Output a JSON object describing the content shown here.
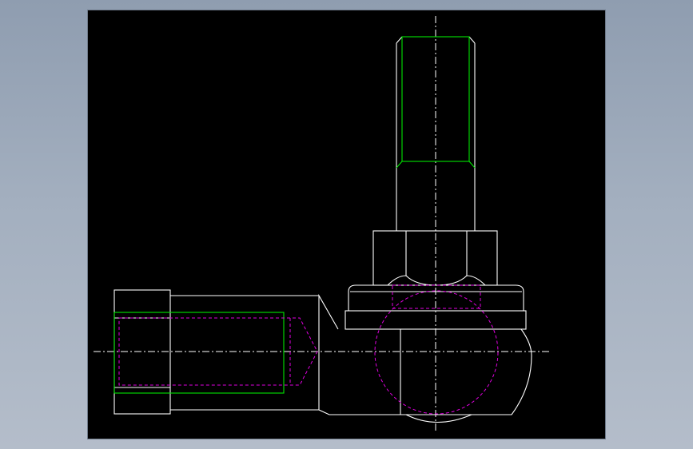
{
  "colors": {
    "background": "#000000",
    "outline": "#ffffff",
    "thread": "#00e600",
    "hidden": "#e100e1",
    "centerline": "#ffffff"
  },
  "drawing": {
    "view": "cad-viewport",
    "subject": "rod-end-ball-joint",
    "layers": [
      "outline",
      "thread",
      "hidden",
      "centerline"
    ]
  }
}
